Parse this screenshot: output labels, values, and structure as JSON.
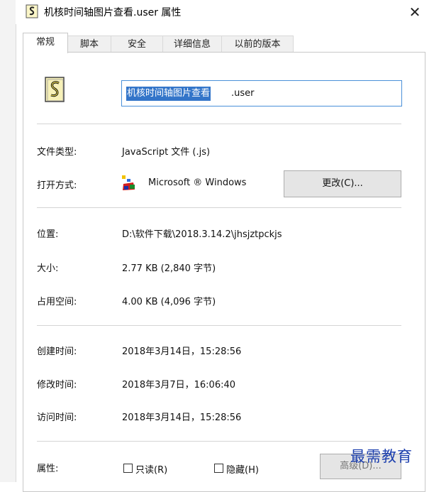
{
  "window": {
    "title": "机核时间轴图片查看.user 属性",
    "close_symbol": "✕"
  },
  "tabs": [
    {
      "label": "常规",
      "active": true
    },
    {
      "label": "脚本",
      "active": false
    },
    {
      "label": "安全",
      "active": false
    },
    {
      "label": "详细信息",
      "active": false
    },
    {
      "label": "以前的版本",
      "active": false
    }
  ],
  "general": {
    "file_icon": "javascript-file-icon",
    "file_name_selected": "机核时间轴图片查看",
    "file_name_ext": ".user",
    "file_type_label": "文件类型:",
    "file_type_value": "JavaScript 文件 (.js)",
    "open_with_label": "打开方式:",
    "open_with_value": "Microsoft ® Windows",
    "change_button": "更改(C)...",
    "location_label": "位置:",
    "location_value": "D:\\软件下载\\2018.3.14.2\\jhsjztpckjs",
    "size_label": "大小:",
    "size_value": "2.77 KB (2,840 字节)",
    "size_on_disk_label": "占用空间:",
    "size_on_disk_value": "4.00 KB (4,096 字节)",
    "created_label": "创建时间:",
    "created_value": "2018年3月14日，15:28:56",
    "modified_label": "修改时间:",
    "modified_value": "2018年3月7日，16:06:40",
    "accessed_label": "访问时间:",
    "accessed_value": "2018年3月14日，15:28:56",
    "attributes_label": "属性:",
    "readonly_label": "只读(R)",
    "readonly_checked": false,
    "hidden_label": "隐藏(H)",
    "hidden_checked": false,
    "advanced_button": "高级(D)..."
  },
  "watermark": "最需教育",
  "colors": {
    "selection": "#3375c9",
    "focus_border": "#4a90d9",
    "watermark": "#1c3fae"
  }
}
